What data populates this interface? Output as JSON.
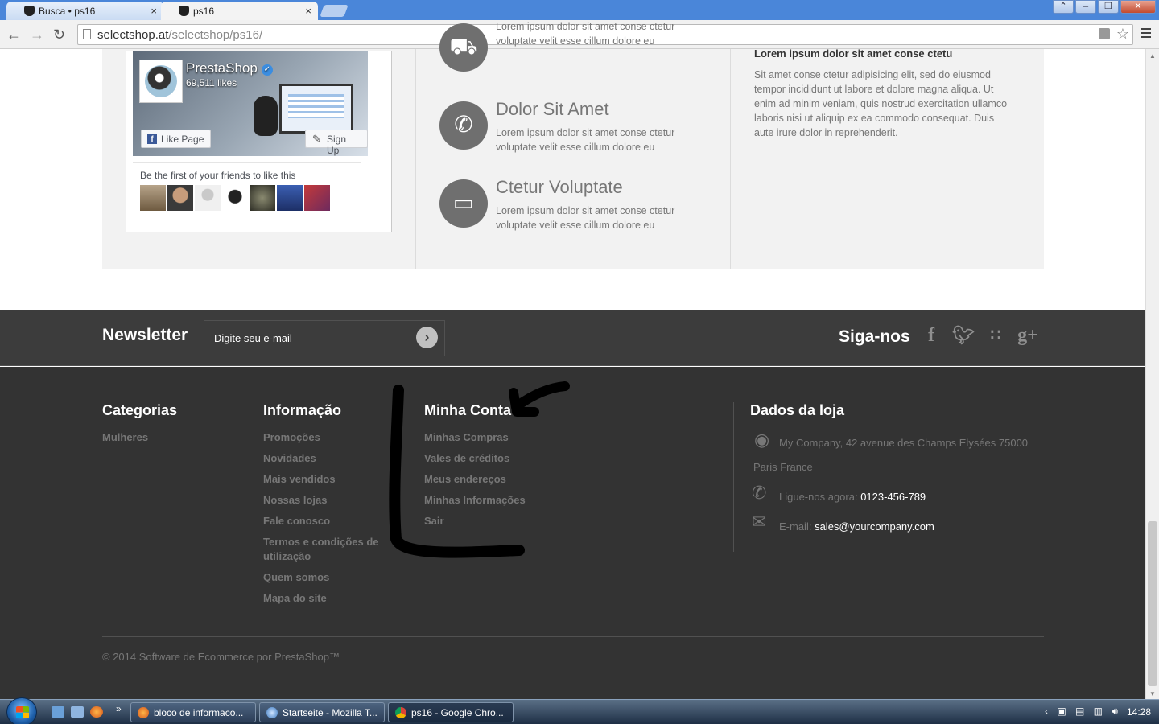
{
  "browser": {
    "tabs": [
      {
        "title": "Busca • ps16",
        "close": "×"
      },
      {
        "title": "ps16",
        "close": "×"
      }
    ],
    "url_host": "selectshop.at",
    "url_path": "/selectshop/ps16/",
    "window_buttons": [
      "⌃",
      "–",
      "❐",
      "✕"
    ]
  },
  "facebook": {
    "page_name": "PrestaShop",
    "likes": "69,511 likes",
    "like_button": "Like Page",
    "signup_button": "Sign Up",
    "friends_text": "Be the first of your friends to like this"
  },
  "features": [
    {
      "title": "",
      "text": "Lorem ipsum dolor sit amet conse ctetur voluptate velit esse cillum dolore eu",
      "icon": "truck-icon"
    },
    {
      "title": "Dolor Sit Amet",
      "text": "Lorem ipsum dolor sit amet conse ctetur voluptate velit esse cillum dolore eu",
      "icon": "phone-icon"
    },
    {
      "title": "Ctetur Voluptate",
      "text": "Lorem ipsum dolor sit amet conse ctetur voluptate velit esse cillum dolore eu",
      "icon": "credit-card-icon"
    }
  ],
  "cms_block": {
    "title": "Lorem ipsum dolor sit amet conse ctetu",
    "text": "Sit amet conse ctetur adipisicing elit, sed do eiusmod tempor incididunt ut labore et dolore magna aliqua. Ut enim ad minim veniam, quis nostrud exercitation ullamco laboris nisi ut aliquip ex ea commodo consequat. Duis aute irure dolor in reprehenderit."
  },
  "newsletter": {
    "title": "Newsletter",
    "placeholder": "Digite seu e-mail",
    "submit": "›"
  },
  "social": {
    "title": "Siga-nos",
    "icons": [
      "facebook-icon",
      "twitter-icon",
      "rss-icon",
      "google-plus-icon"
    ]
  },
  "footer": {
    "categorias": {
      "title": "Categorias",
      "items": [
        "Mulheres"
      ]
    },
    "informacao": {
      "title": "Informação",
      "items": [
        "Promoções",
        "Novidades",
        "Mais vendidos",
        "Nossas lojas",
        "Fale conosco",
        "Termos e condições de utilização",
        "Quem somos",
        "Mapa do site"
      ]
    },
    "minha_conta": {
      "title": "Minha Conta",
      "items": [
        "Minhas Compras",
        "Vales de créditos",
        "Meus endereços",
        "Minhas Informações",
        "Sair"
      ]
    },
    "store": {
      "title": "Dados da loja",
      "address_line1": "My Company, 42 avenue des Champs Elysées 75000",
      "address_line2": "Paris France",
      "phone_label": "Ligue-nos agora:",
      "phone": "0123-456-789",
      "email_label": "E-mail:",
      "email": "sales@yourcompany.com"
    },
    "copyright": "© 2014 Software de Ecommerce por PrestaShop™"
  },
  "taskbar": {
    "tasks": [
      "bloco de informaco...",
      "Startseite - Mozilla T...",
      "ps16 - Google Chro..."
    ],
    "clock": "14:28",
    "overflow": "»"
  }
}
